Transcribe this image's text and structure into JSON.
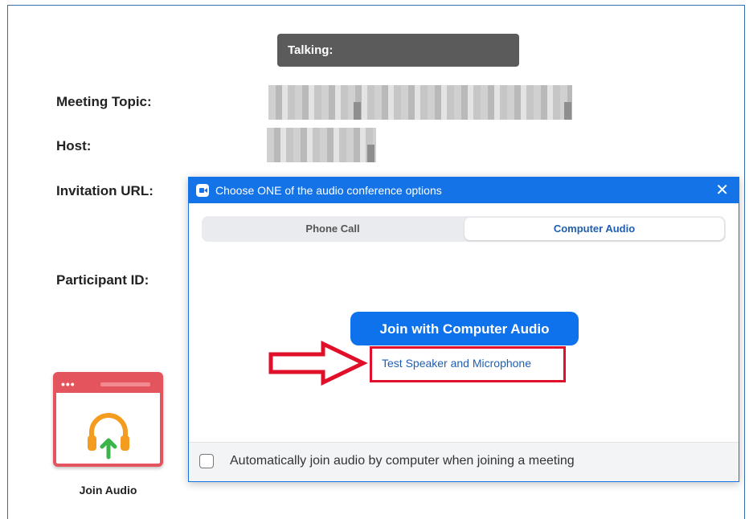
{
  "talking_bar": {
    "label": "Talking:"
  },
  "meeting_info": {
    "topic_label": "Meeting Topic:",
    "host_label": "Host:",
    "invitation_label": "Invitation URL:",
    "participant_label": "Participant ID:"
  },
  "join_audio_tile": {
    "label": "Join Audio",
    "icon": "headphones-icon"
  },
  "dialog": {
    "title": "Choose ONE of the audio conference options",
    "close_label": "✕",
    "tabs": [
      {
        "label": "Phone Call",
        "selected": false
      },
      {
        "label": "Computer Audio",
        "selected": true
      }
    ],
    "join_button_label": "Join with Computer Audio",
    "test_link_label": "Test Speaker and Microphone",
    "auto_join_label": "Automatically join audio by computer when joining a meeting",
    "auto_join_checked": false
  },
  "colors": {
    "accent": "#0e72ed",
    "titlebar": "#1473e6",
    "highlight": "#e0102a",
    "tile": "#e4545c"
  }
}
